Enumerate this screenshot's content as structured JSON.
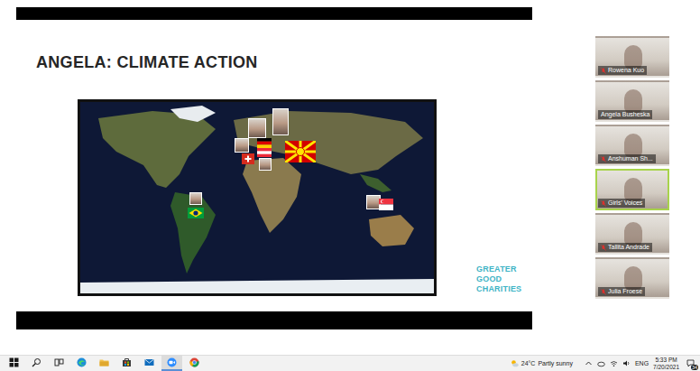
{
  "slide": {
    "title": "ANGELA: CLIMATE ACTION",
    "logo": [
      "GREATER",
      "GOOD",
      "CHARITIES"
    ]
  },
  "participants": [
    {
      "name": "Rowena Kuo",
      "muted": true,
      "selected": false
    },
    {
      "name": "Angela Busheska",
      "muted": false,
      "selected": false
    },
    {
      "name": "Anshuman Sh...",
      "muted": true,
      "selected": false
    },
    {
      "name": "Girls' Voices",
      "muted": true,
      "selected": true
    },
    {
      "name": "Tallita Andrade",
      "muted": true,
      "selected": false
    },
    {
      "name": "Julia Froese",
      "muted": true,
      "selected": false
    }
  ],
  "taskbar": {
    "items": [
      {
        "kind": "windows",
        "selected": false
      },
      {
        "kind": "search",
        "selected": false
      },
      {
        "kind": "task-view",
        "selected": false
      },
      {
        "kind": "edge",
        "selected": false
      },
      {
        "kind": "explorer",
        "selected": false
      },
      {
        "kind": "store",
        "selected": false
      },
      {
        "kind": "mail",
        "selected": false
      },
      {
        "kind": "zoom",
        "selected": true
      },
      {
        "kind": "chrome",
        "selected": false
      }
    ],
    "weather": {
      "temperature": "24°C",
      "condition": "Partly sunny"
    },
    "language": "ENG",
    "time": "5:33 PM",
    "date": "7/20/2021",
    "notifications": "34"
  }
}
